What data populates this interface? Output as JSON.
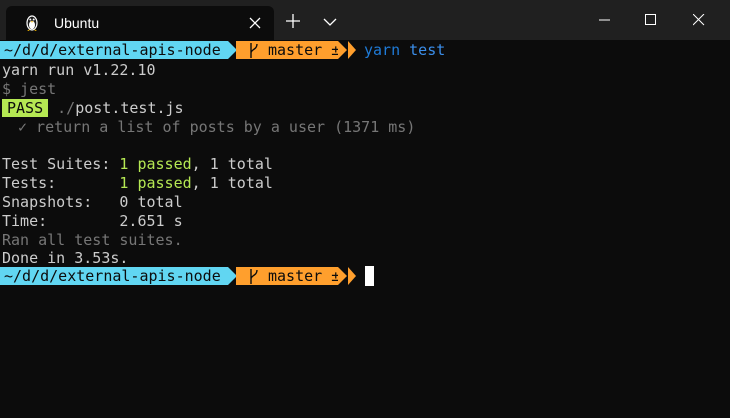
{
  "window": {
    "tab_title": "Ubuntu",
    "tab_icon": "linux-penguin-icon",
    "colors": {
      "titlebar": "#202020",
      "terminal_bg": "#0c0c0c",
      "path_segment": "#61d6f2",
      "git_segment": "#ff9f2d",
      "success": "#b5e853"
    }
  },
  "terminal": {
    "prompt1": {
      "path": "~/d/d/external-apis-node",
      "branch": "master ±"
    },
    "command1": {
      "bin": "yarn",
      "arg": "test"
    },
    "lines": {
      "yarn_version": "yarn run v1.22.10",
      "jest_cmd": "$ jest",
      "pass_badge": "PASS",
      "test_dir": "./",
      "test_file": "post.test.js",
      "test_case": "✓ return a list of posts by a user (1371 ms)",
      "suites_label": "Test Suites: ",
      "suites_passed": "1 passed",
      "suites_total": ", 1 total",
      "tests_label": "Tests:       ",
      "tests_passed": "1 passed",
      "tests_total": ", 1 total",
      "snapshots": "Snapshots:   0 total",
      "time": "Time:        2.651 s",
      "ran_all": "Ran all test suites.",
      "done": "Done in 3.53s."
    },
    "prompt2": {
      "path": "~/d/d/external-apis-node",
      "branch": "master ±"
    }
  }
}
